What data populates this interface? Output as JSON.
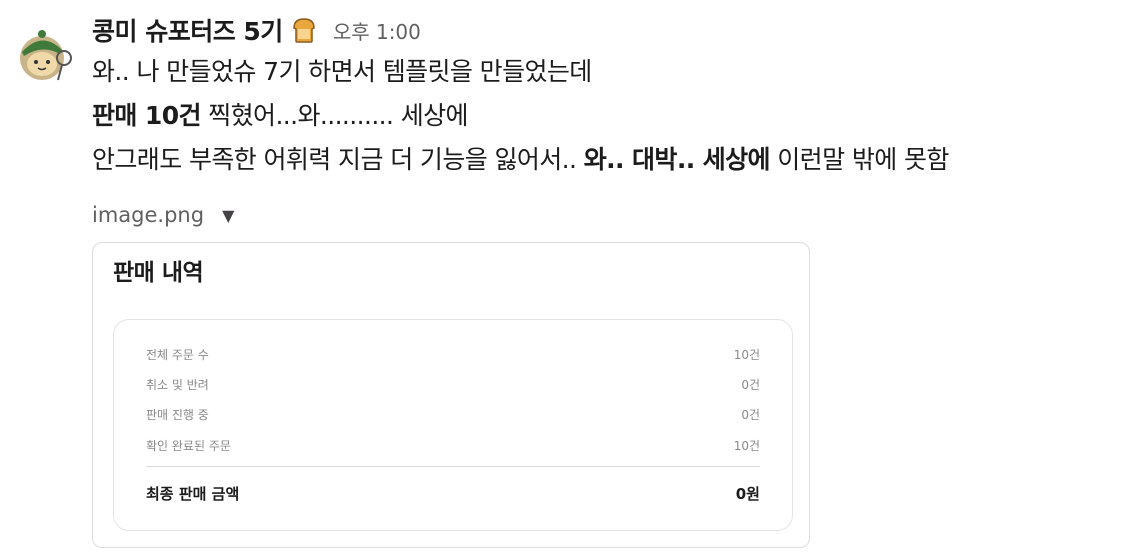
{
  "message": {
    "sender": "콩미 슈포터즈 5기",
    "sender_emoji": "bread-icon",
    "time": "오후 1:00",
    "line1": "와.. 나 만들었슈 7기 하면서 템플릿을 만들었는데",
    "line2_bold": "판매 10건",
    "line2_rest": " 찍혔어...와.......... 세상에",
    "line3_part1": "안그래도 부족한 어휘력 지금 더 기능을 잃어서.. ",
    "line3_bold": "와.. 대박.. 세상에",
    "line3_part2": " 이런말 밖에 못함"
  },
  "attachment": {
    "filename": "image.png",
    "caret": "▼"
  },
  "card": {
    "title": "판매 내역",
    "rows": [
      {
        "label": "전체 주문 수",
        "value": "10건"
      },
      {
        "label": "취소 및 반려",
        "value": "0건"
      },
      {
        "label": "판매 진행 중",
        "value": "0건"
      },
      {
        "label": "확인 완료된 주문",
        "value": "10건"
      }
    ],
    "total_label": "최종 판매 금액",
    "total_value": "0원"
  }
}
